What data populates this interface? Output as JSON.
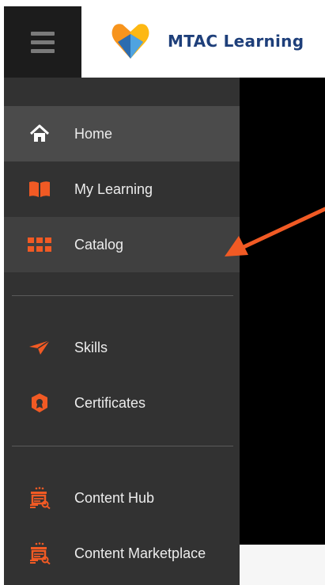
{
  "header": {
    "brand_name": "MTAC Learning",
    "menu_icon": "hamburger-menu-icon",
    "logo_icon": "heart-logo-icon"
  },
  "sidebar": {
    "items": [
      {
        "label": "Home",
        "icon": "home-icon",
        "state": "active"
      },
      {
        "label": "My Learning",
        "icon": "open-book-icon"
      },
      {
        "label": "Catalog",
        "icon": "grid-icon",
        "state": "hovered"
      },
      {
        "label": "Skills",
        "icon": "paper-plane-icon"
      },
      {
        "label": "Certificates",
        "icon": "certificate-badge-icon"
      },
      {
        "label": "Content Hub",
        "icon": "content-hub-icon"
      },
      {
        "label": "Content Marketplace",
        "icon": "content-marketplace-icon"
      }
    ]
  },
  "annotation": {
    "icon": "orange-arrow-pointing-to-catalog"
  },
  "colors": {
    "accent": "#f15a24",
    "sidebar_bg": "#323232",
    "brand_text": "#1e3f7a",
    "logo_orange": "#f7941d",
    "logo_blue": "#2b6cb0"
  }
}
